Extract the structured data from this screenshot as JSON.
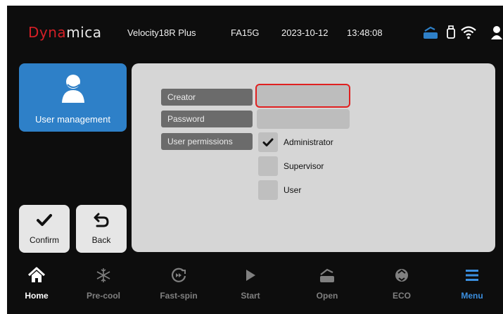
{
  "header": {
    "logo": {
      "part1": "Dy",
      "part2": "na",
      "part3": "mica"
    },
    "model": "Velocity18R Plus",
    "rotor": "FA15G",
    "date": "2023-10-12",
    "time": "13:48:08",
    "status_icons": [
      "lid-open-icon",
      "usb-icon",
      "wifi-icon",
      "user-icon"
    ]
  },
  "sidebar": {
    "user_management_label": "User management",
    "confirm_label": "Confirm",
    "back_label": "Back"
  },
  "form": {
    "creator_label": "Creator",
    "creator_value": "",
    "password_label": "Password",
    "password_value": "",
    "permissions_label": "User permissions",
    "permissions": [
      {
        "label": "Administrator",
        "checked": true
      },
      {
        "label": "Supervisor",
        "checked": false
      },
      {
        "label": "User",
        "checked": false
      }
    ]
  },
  "nav": {
    "items": [
      {
        "label": "Home",
        "icon": "home-icon",
        "state": "active"
      },
      {
        "label": "Pre-cool",
        "icon": "snowflake-icon",
        "state": "disabled"
      },
      {
        "label": "Fast-spin",
        "icon": "fast-spin-icon",
        "state": "disabled"
      },
      {
        "label": "Start",
        "icon": "play-icon",
        "state": "disabled"
      },
      {
        "label": "Open",
        "icon": "lid-open-icon",
        "state": "disabled"
      },
      {
        "label": "ECO",
        "icon": "eco-icon",
        "state": "disabled"
      },
      {
        "label": "Menu",
        "icon": "menu-icon",
        "state": "selected"
      }
    ]
  },
  "colors": {
    "background": "#0d0d0d",
    "accent_blue": "#2e80c8",
    "menu_blue": "#3b8fe0",
    "field_label_gray": "#6b6b6b",
    "panel_gray": "#d6d6d6",
    "highlight_red": "#e02020",
    "logo_red": "#d41f26",
    "nav_disabled": "#808080"
  }
}
